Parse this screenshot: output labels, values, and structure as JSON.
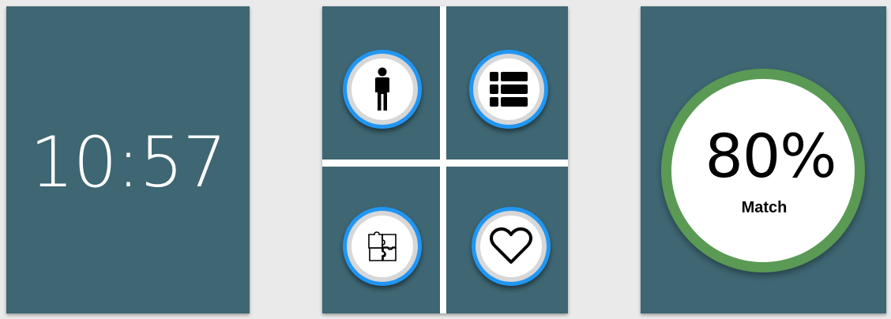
{
  "clock": {
    "time": "10:57"
  },
  "menu": {
    "buttons": [
      {
        "icon": "person-icon"
      },
      {
        "icon": "list-icon"
      },
      {
        "icon": "puzzle-icon"
      },
      {
        "icon": "heart-icon"
      }
    ]
  },
  "match": {
    "value": "80%",
    "label": "Match",
    "ring_color": "#5a9a55"
  },
  "colors": {
    "screen_bg": "#3e6673",
    "button_ring": "#2196f3",
    "page_bg": "#eaeaea"
  }
}
